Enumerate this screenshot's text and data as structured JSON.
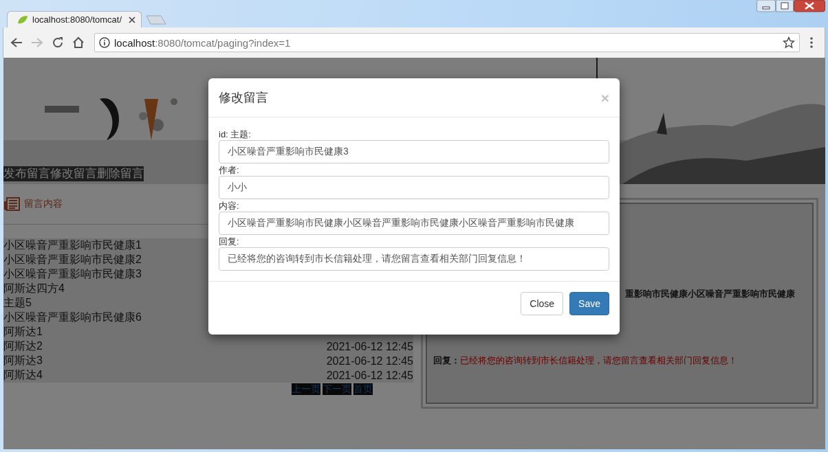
{
  "browser": {
    "tab_title": "localhost:8080/tomcat/",
    "url_host": "localhost",
    "url_path": ":8080/tomcat/paging?index=1"
  },
  "page": {
    "nav_links": [
      "发布留言",
      "修改留言",
      "删除留言"
    ],
    "section_title": "留言内容",
    "messages": [
      {
        "title": "小区噪音严重影响市民健康1"
      },
      {
        "title": "小区噪音严重影响市民健康2"
      },
      {
        "title": "小区噪音严重影响市民健康3"
      },
      {
        "title": "阿斯达四方4"
      },
      {
        "title": "主题5"
      },
      {
        "title": "小区噪音严重影响市民健康6"
      },
      {
        "title": "阿斯达1"
      },
      {
        "title": "阿斯达2",
        "time": "2021-06-12 12:45"
      },
      {
        "title": "阿斯达3",
        "time": "2021-06-12 12:45"
      },
      {
        "title": "阿斯达4",
        "time": "2021-06-12 12:45"
      }
    ],
    "pager": [
      "上一页",
      "下一页",
      "首页"
    ],
    "detail": {
      "content_fragment": "重影响市民健康小区噪音严重影响市民健康",
      "reply_label": "回复：",
      "reply": "已经将您的咨询转到市长信籍处理，请您留言查看相关部门回复信息！"
    }
  },
  "modal": {
    "title": "修改留言",
    "close": "×",
    "fields": [
      {
        "label": "id: 主题:",
        "value": "小区噪音严重影响市民健康3"
      },
      {
        "label": "作者:",
        "value": "小小"
      },
      {
        "label": "内容:",
        "value": "小区噪音严重影响市民健康小区噪音严重影响市民健康小区噪音严重影响市民健康"
      },
      {
        "label": "回复:",
        "value": "已经将您的咨询转到市长信籍处理，请您留言查看相关部门回复信息！"
      }
    ],
    "buttons": [
      {
        "label": "Close",
        "kind": "default"
      },
      {
        "label": "Save",
        "kind": "primary"
      }
    ]
  }
}
